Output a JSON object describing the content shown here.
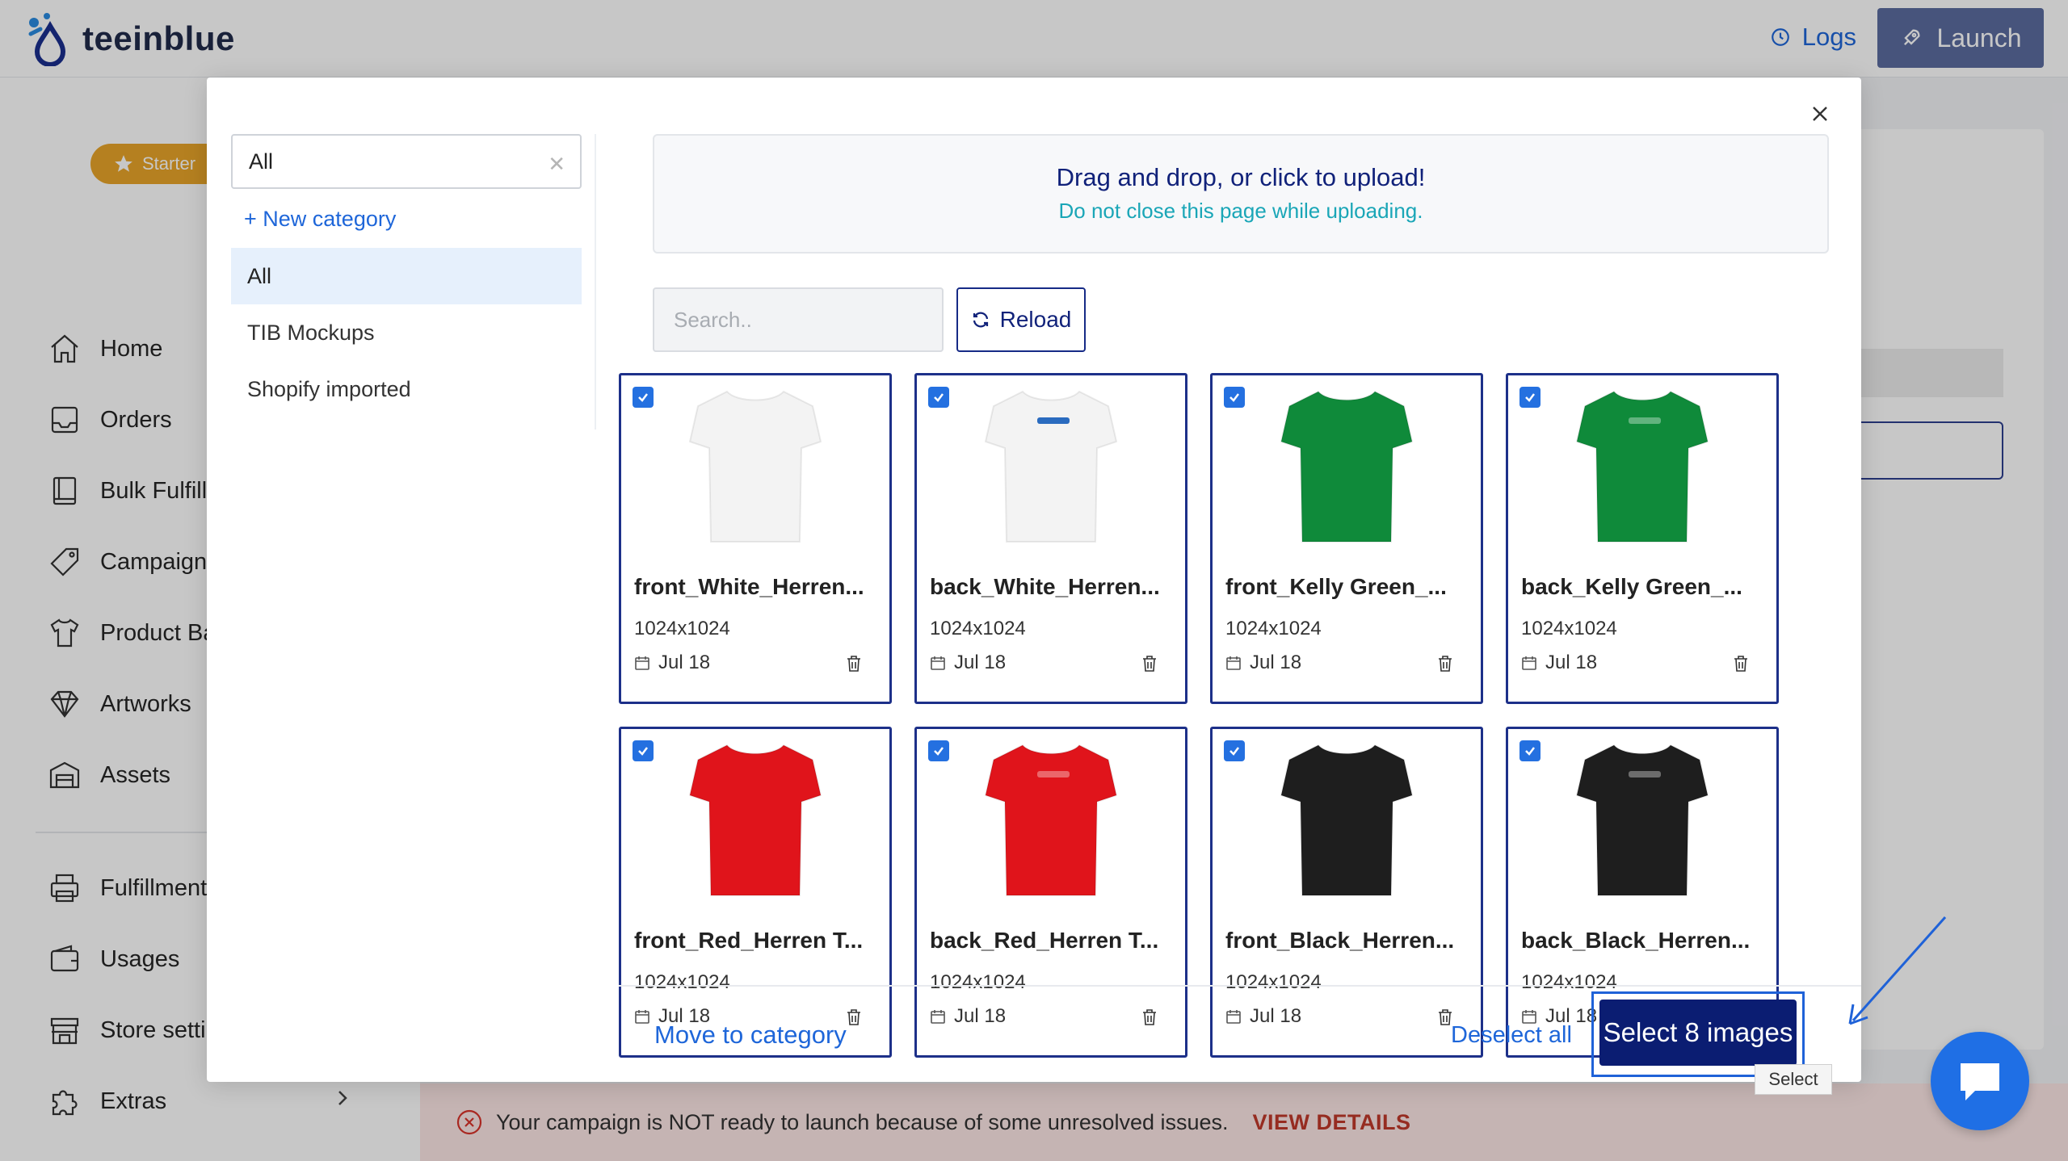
{
  "app": {
    "brand": "teeinblue",
    "logs_label": "Logs",
    "launch_label": "Launch"
  },
  "sidebar": {
    "plan_badge": "Starter",
    "items": [
      {
        "label": "Home",
        "icon": "home-icon"
      },
      {
        "label": "Orders",
        "icon": "inbox-icon"
      },
      {
        "label": "Bulk Fulfill",
        "icon": "book-icon"
      },
      {
        "label": "Campaigns",
        "icon": "tag-icon"
      },
      {
        "label": "Product Ba",
        "icon": "shirt-icon"
      },
      {
        "label": "Artworks",
        "icon": "diamond-icon"
      },
      {
        "label": "Assets",
        "icon": "warehouse-icon"
      },
      {
        "label": "Fulfillment",
        "icon": "printer-icon"
      },
      {
        "label": "Usages",
        "icon": "wallet-icon"
      },
      {
        "label": "Store setti",
        "icon": "store-icon"
      },
      {
        "label": "Extras",
        "icon": "puzzle-icon"
      }
    ]
  },
  "warning": {
    "text": "Your campaign is NOT ready to launch because of some unresolved issues.",
    "link": "VIEW DETAILS"
  },
  "modal": {
    "category_select_value": "All",
    "new_category_label": "+ New category",
    "categories": [
      "All",
      "TIB Mockups",
      "Shopify imported"
    ],
    "active_category": "All",
    "upload_main": "Drag and drop, or click to upload!",
    "upload_sub": "Do not close this page while uploading.",
    "search_placeholder": "Search..",
    "reload_label": "Reload",
    "images": [
      {
        "name": "front_White_Herren...",
        "size": "1024x1024",
        "date": "Jul 18",
        "color": "#f3f3f3",
        "logo": false,
        "checked": true
      },
      {
        "name": "back_White_Herren...",
        "size": "1024x1024",
        "date": "Jul 18",
        "color": "#f3f3f3",
        "logo": true,
        "checked": true
      },
      {
        "name": "front_Kelly Green_...",
        "size": "1024x1024",
        "date": "Jul 18",
        "color": "#0f8a3a",
        "logo": false,
        "checked": true
      },
      {
        "name": "back_Kelly Green_...",
        "size": "1024x1024",
        "date": "Jul 18",
        "color": "#0f8a3a",
        "logo": true,
        "checked": true
      },
      {
        "name": "front_Red_Herren T...",
        "size": "1024x1024",
        "date": "Jul 18",
        "color": "#e0141b",
        "logo": false,
        "checked": true
      },
      {
        "name": "back_Red_Herren T...",
        "size": "1024x1024",
        "date": "Jul 18",
        "color": "#e0141b",
        "logo": true,
        "checked": true
      },
      {
        "name": "front_Black_Herren...",
        "size": "1024x1024",
        "date": "Jul 18",
        "color": "#1e1e1e",
        "logo": false,
        "checked": true
      },
      {
        "name": "back_Black_Herren...",
        "size": "1024x1024",
        "date": "Jul 18",
        "color": "#1e1e1e",
        "logo": true,
        "checked": true
      }
    ],
    "move_category_label": "Move to category",
    "deselect_label": "Deselect all",
    "select_label": "Select 8 images",
    "tooltip": "Select"
  },
  "colors": {
    "primary": "#0b1d72",
    "link": "#1e66d9",
    "accent_cyan": "#1aa6b7",
    "chat": "#1f6fe5"
  }
}
